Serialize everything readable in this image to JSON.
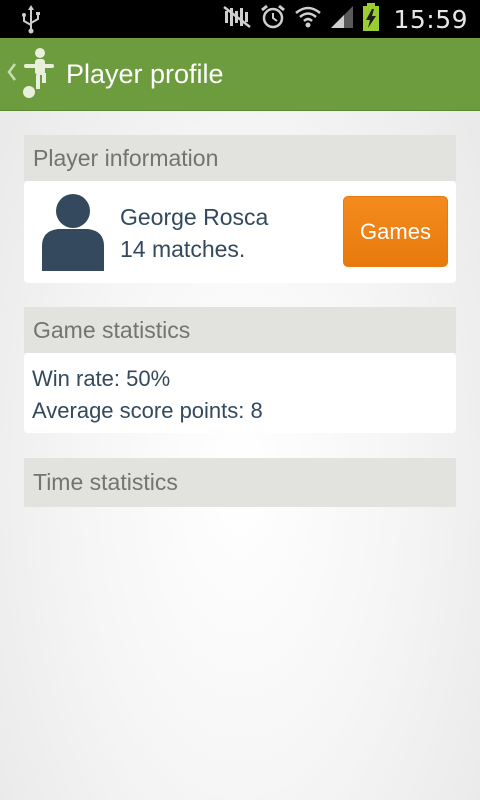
{
  "status_bar": {
    "time": "15:59",
    "icons": [
      "usb-icon",
      "mute-icon",
      "alarm-icon",
      "wifi-icon",
      "signal-icon",
      "battery-charging-icon"
    ]
  },
  "action_bar": {
    "title": "Player profile",
    "up_icon": "chevron-left-icon",
    "app_icon": "foosball-player-icon",
    "color": "#6d9c3f"
  },
  "player_information": {
    "header": "Player information",
    "name": "George Rosca",
    "matches": "14 matches.",
    "games_button": "Games",
    "avatar_icon": "person-icon"
  },
  "game_statistics": {
    "header": "Game statistics",
    "win_rate": "Win rate: 50%",
    "average_score": "Average score points: 8"
  },
  "time_statistics": {
    "header": "Time statistics"
  },
  "colors": {
    "accent_green": "#6d9c3f",
    "button_orange": "#f48a1e",
    "text_dark": "#34495e",
    "header_bg": "#e2e2de"
  }
}
